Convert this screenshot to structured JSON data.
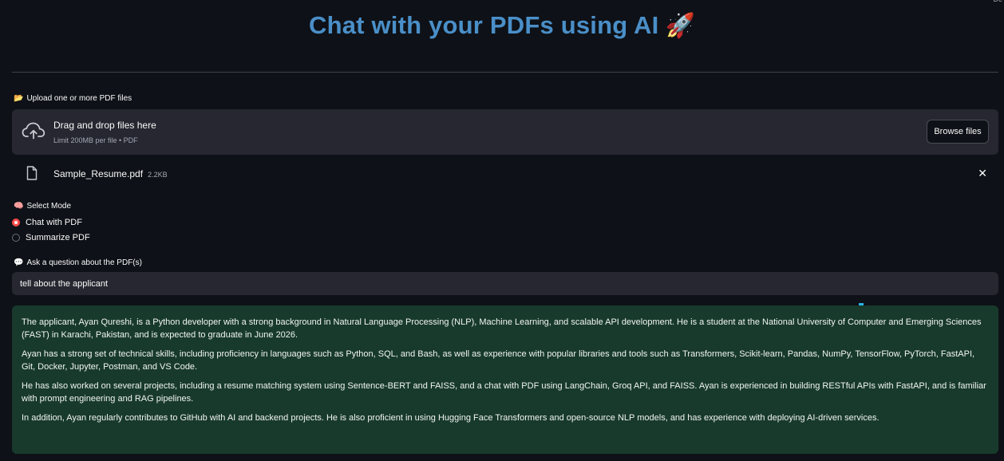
{
  "page": {
    "title": "Chat with your PDFs using AI",
    "title_icon": "🚀",
    "corner_text": "De"
  },
  "uploader": {
    "label_icon": "📂",
    "label": "Upload one or more PDF files",
    "drag_text": "Drag and drop files here",
    "limit_text": "Limit 200MB per file • PDF",
    "browse_label": "Browse files",
    "icon": "cloud-upload-icon"
  },
  "file": {
    "name": "Sample_Resume.pdf",
    "size": "2.2KB",
    "icon": "file-icon",
    "close_glyph": "✕"
  },
  "mode": {
    "label_icon": "🧠",
    "label": "Select Mode",
    "options": [
      {
        "label": "Chat with PDF",
        "selected": true
      },
      {
        "label": "Summarize PDF",
        "selected": false
      }
    ]
  },
  "question": {
    "label_icon": "💬",
    "label": "Ask a question about the PDF(s)",
    "value": "tell about the applicant"
  },
  "answer": {
    "paragraphs": [
      "The applicant, Ayan Qureshi, is a Python developer with a strong background in Natural Language Processing (NLP), Machine Learning, and scalable API development. He is a student at the National University of Computer and Emerging Sciences (FAST) in Karachi, Pakistan, and is expected to graduate in June 2026.",
      "Ayan has a strong set of technical skills, including proficiency in languages such as Python, SQL, and Bash, as well as experience with popular libraries and tools such as Transformers, Scikit-learn, Pandas, NumPy, TensorFlow, PyTorch, FastAPI, Git, Docker, Jupyter, Postman, and VS Code.",
      "He has also worked on several projects, including a resume matching system using Sentence-BERT and FAISS, and a chat with PDF using LangChain, Groq API, and FAISS. Ayan is experienced in building RESTful APIs with FastAPI, and is familiar with prompt engineering and RAG pipelines.",
      "In addition, Ayan regularly contributes to GitHub with AI and backend projects. He is also proficient in using Hugging Face Transformers and open-source NLP models, and has experience with deploying AI-driven services."
    ]
  },
  "colors": {
    "background": "#0e1117",
    "title": "#4a8fc8",
    "panel": "#262730",
    "success_bg": "#183a2c",
    "radio_accent": "#ff4b4b"
  }
}
